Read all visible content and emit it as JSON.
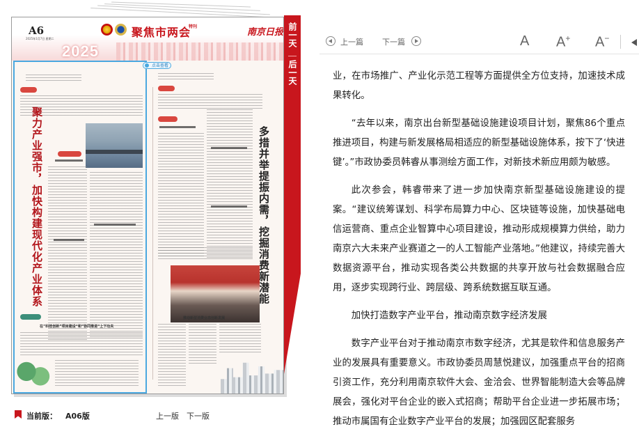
{
  "newspaper": {
    "page_code": "A6",
    "page_date": "2025年1月7日 星期二",
    "section_title": "聚焦市两会",
    "special_tag": "特刊",
    "brand": "南京日报",
    "banner_year": "2025",
    "selection_badge": "点击查看",
    "headline_left": "聚力产业强市，加快构建现代化产业体系",
    "headline_right": "多措并举提振内需，挖掘消费新潜能",
    "caption_left": "在“科技创新”项目建设“和”协同推进“上下功夫",
    "caption_right": "推动新型消费业态创新发展"
  },
  "ribbon": {
    "prev_label": "前一天",
    "next_label": "后一天"
  },
  "bottom_bar": {
    "current_label": "当前版：",
    "current_value": "A06版",
    "prev_page": "上一版",
    "next_page": "下一版"
  },
  "toolbar": {
    "prev_article": "上一篇",
    "next_article": "下一篇",
    "font_normal": "A",
    "font_increase": "A",
    "font_decrease": "A",
    "plus": "+",
    "minus": "−"
  },
  "article": {
    "p1": "业，在市场推广、产业化示范工程等方面提供全方位支持，加速技术成果转化。",
    "p2": "“去年以来，南京出台新型基础设施建设项目计划，聚焦86个重点推进项目，构建与新发展格局相适应的新型基础设施体系，按下了‘快进键’。”市政协委员韩睿从事测绘方面工作，对新技术新应用颇为敏感。",
    "p3": "此次参会，韩睿带来了进一步加快南京新型基础设施建设的提案。“建议统筹谋划、科学布局算力中心、区块链等设施，加快基础电信运营商、重点企业智算中心项目建设，推动形成规模算力供给，助力南京六大未来产业赛道之一的人工智能产业落地。”他建议，持续完善大数据资源平台，推动实现各类公共数据的共享开放与社会数据融合应用，逐步实现跨行业、跨层级、跨系统数据互联互通。",
    "subhead": "加快打造数字产业平台，推动南京数字经济发展",
    "p4": "数字产业平台对于推动南京市数字经济，尤其是软件和信息服务产业的发展具有重要意义。市政协委员周慧悦建议，加强重点平台的招商引资工作，充分利用南京软件大会、金洽会、世界智能制造大会等品牌展会，强化对平台企业的嵌入式招商；帮助平台企业进一步拓展市场；推动市属国有企业数字产业平台的发展；加强园区配套服务"
  }
}
